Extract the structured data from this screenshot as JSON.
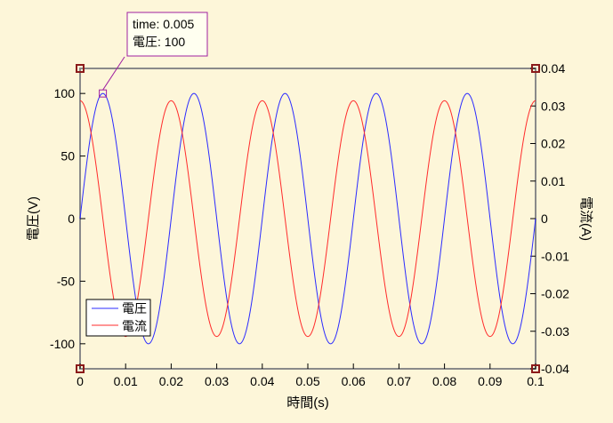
{
  "colors": {
    "background": "#fdf6d9",
    "voltage": "#2b2bff",
    "current": "#ff2b2b",
    "frame": "#8a8a8a",
    "handle": "#8b1a1a",
    "tooltip_border": "#a020a0"
  },
  "tooltip": {
    "line1": "time: 0.005",
    "line2": "電圧: 100"
  },
  "chart_data": {
    "type": "line",
    "xlabel": "時間(s)",
    "ylabel": "電圧(V)",
    "y2label": "電流(A)",
    "xlim": [
      0,
      0.1
    ],
    "ylim": [
      -120,
      120
    ],
    "y2lim": [
      -0.04,
      0.04
    ],
    "x_ticks": [
      "0",
      "0.01",
      "0.02",
      "0.03",
      "0.04",
      "0.05",
      "0.06",
      "0.07",
      "0.08",
      "0.09",
      "0.1"
    ],
    "x_tick_values": [
      0,
      0.01,
      0.02,
      0.03,
      0.04,
      0.05,
      0.06,
      0.07,
      0.08,
      0.09,
      0.1
    ],
    "y_ticks": [
      "100",
      "50",
      "0",
      "-50",
      "-100"
    ],
    "y_tick_values": [
      100,
      50,
      0,
      -50,
      -100
    ],
    "y2_ticks": [
      "0.04",
      "0.03",
      "0.02",
      "0.01",
      "0",
      "-0.01",
      "-0.02",
      "-0.03",
      "-0.04"
    ],
    "y2_tick_values": [
      0.04,
      0.03,
      0.02,
      0.01,
      0,
      -0.01,
      -0.02,
      -0.03,
      -0.04
    ],
    "grid": false,
    "legend_position": "bottom-left",
    "series": [
      {
        "name": "電圧",
        "axis": "left",
        "color": "#2b2bff",
        "function": "sine",
        "amplitude": 100,
        "frequency": 50,
        "phase_deg": 0
      },
      {
        "name": "電流",
        "axis": "right",
        "color": "#ff2b2b",
        "function": "sine",
        "amplitude": 0.0314,
        "frequency": 50,
        "phase_deg": 90
      }
    ],
    "marker": {
      "x": 0.005,
      "y": 100
    }
  }
}
